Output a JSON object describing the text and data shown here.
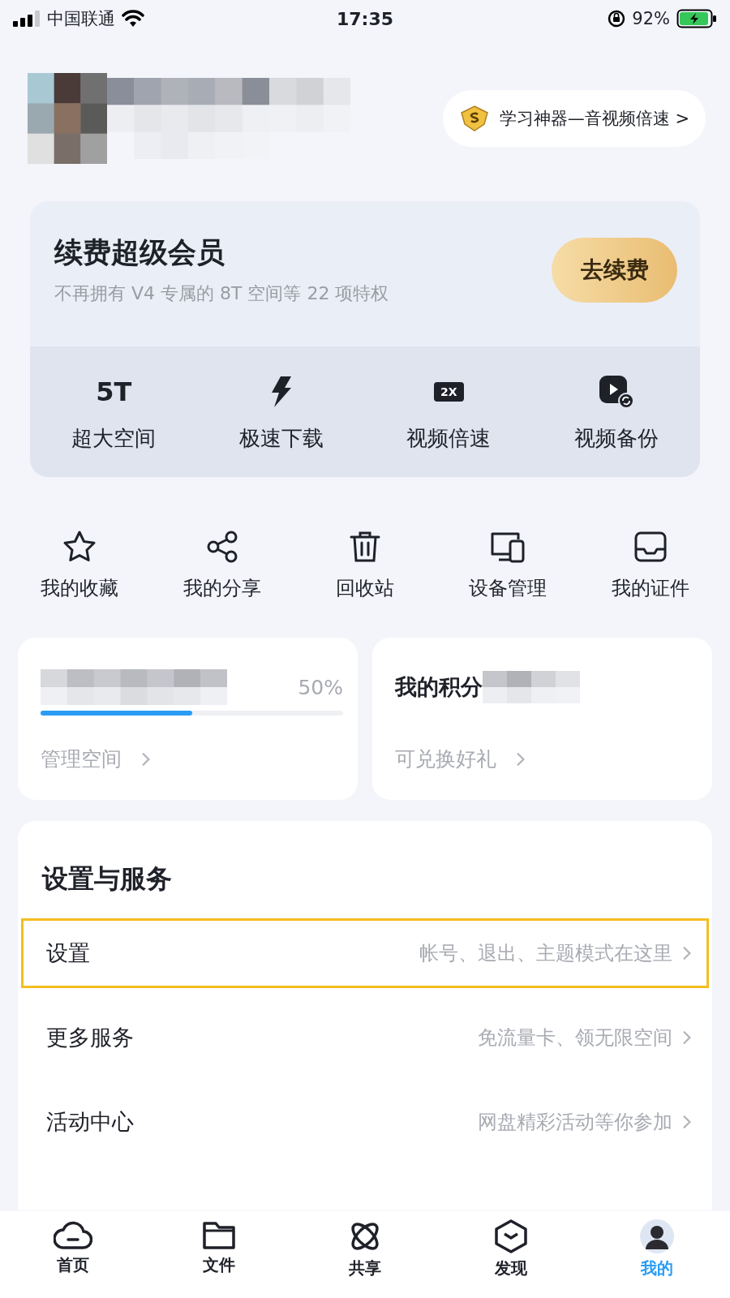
{
  "status_bar": {
    "carrier": "中国联通",
    "time": "17:35",
    "battery": "92%"
  },
  "profile": {
    "promo": "学习神器—音视频倍速 >"
  },
  "renew": {
    "title": "续费超级会员",
    "subtitle": "不再拥有 V4 专属的 8T 空间等 22 项特权",
    "button": "去续费",
    "features": [
      {
        "kind": "size",
        "icon": "5T",
        "label": "超大空间"
      },
      {
        "kind": "bolt",
        "label": "极速下载"
      },
      {
        "kind": "speed",
        "icon": "2X",
        "label": "视频倍速"
      },
      {
        "kind": "backup",
        "label": "视频备份"
      }
    ]
  },
  "shortcuts": [
    {
      "kind": "star",
      "label": "我的收藏"
    },
    {
      "kind": "share",
      "label": "我的分享"
    },
    {
      "kind": "trash",
      "label": "回收站"
    },
    {
      "kind": "devices",
      "label": "设备管理"
    },
    {
      "kind": "card",
      "label": "我的证件"
    }
  ],
  "storage": {
    "percent": "50%",
    "level": 0.5,
    "link": "管理空间"
  },
  "points": {
    "title": "我的积分",
    "link": "可兑换好礼"
  },
  "services": {
    "title": "设置与服务",
    "items": [
      {
        "label": "设置",
        "hint": "帐号、退出、主题模式在这里",
        "selected": true
      },
      {
        "label": "更多服务",
        "hint": "免流量卡、领无限空间",
        "selected": false
      },
      {
        "label": "活动中心",
        "hint": "网盘精彩活动等你参加",
        "selected": false
      }
    ]
  },
  "tabs": [
    {
      "kind": "home",
      "label": "首页",
      "selected": false
    },
    {
      "kind": "files",
      "label": "文件",
      "selected": false
    },
    {
      "kind": "shared",
      "label": "共享",
      "selected": false
    },
    {
      "kind": "discover",
      "label": "发现",
      "selected": false
    },
    {
      "kind": "me",
      "label": "我的",
      "selected": true
    }
  ]
}
